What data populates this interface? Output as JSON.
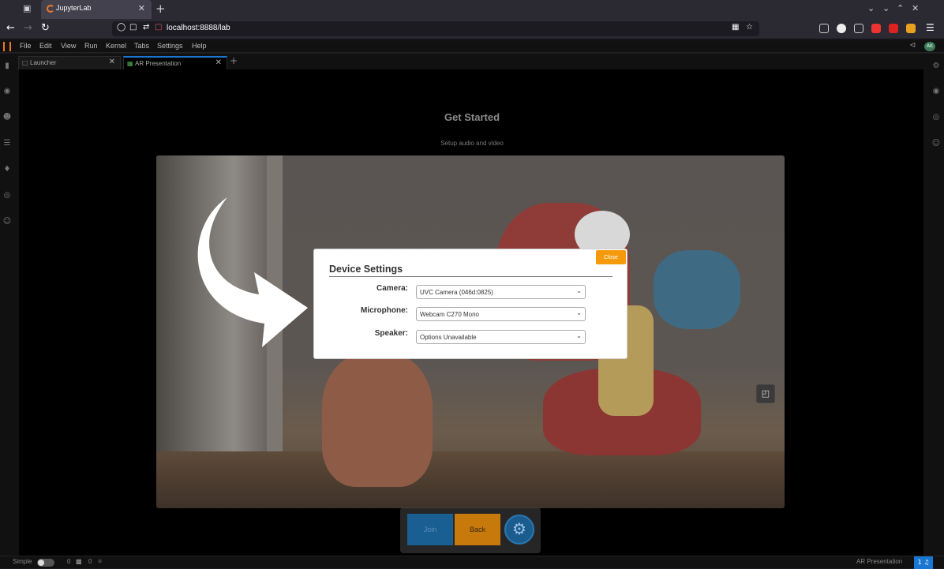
{
  "browser": {
    "tab_title": "JupyterLab",
    "url": "localhost:8888/lab"
  },
  "jupyter": {
    "menu": [
      "File",
      "Edit",
      "View",
      "Run",
      "Kernel",
      "Tabs",
      "Settings",
      "Help"
    ],
    "avatar": "AK",
    "tabs": [
      {
        "label": "Launcher"
      },
      {
        "label": "AR Presentation"
      }
    ]
  },
  "page": {
    "title": "Get Started",
    "subtitle": "Setup audio and video"
  },
  "dialog": {
    "title": "Device Settings",
    "close_label": "Close",
    "camera_label": "Camera:",
    "camera_value": "UVC Camera (046d:0825)",
    "microphone_label": "Microphone:",
    "microphone_value": "Webcam C270 Mono",
    "speaker_label": "Speaker:",
    "speaker_value": "Options Unavailable"
  },
  "controls": {
    "join_label": "Join",
    "back_label": "Back"
  },
  "status": {
    "mode": "Simple",
    "count_a": "0",
    "count_b": "0",
    "doc_name": "AR Presentation",
    "notifications": "1"
  },
  "colors": {
    "accent_orange": "#f59a0b",
    "accent_blue": "#1976d2"
  }
}
